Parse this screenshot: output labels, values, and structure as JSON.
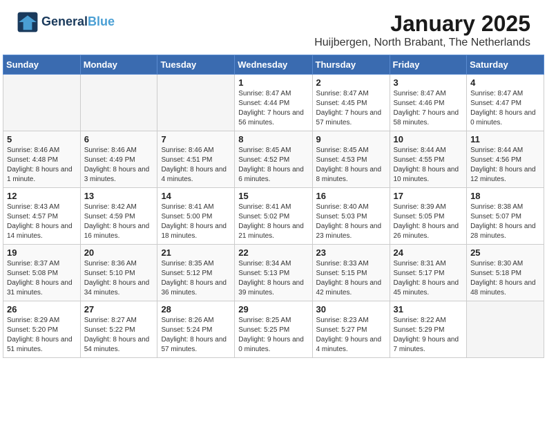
{
  "logo": {
    "line1": "General",
    "line2": "Blue"
  },
  "header": {
    "month": "January 2025",
    "location": "Huijbergen, North Brabant, The Netherlands"
  },
  "weekdays": [
    "Sunday",
    "Monday",
    "Tuesday",
    "Wednesday",
    "Thursday",
    "Friday",
    "Saturday"
  ],
  "weeks": [
    [
      {
        "day": "",
        "info": ""
      },
      {
        "day": "",
        "info": ""
      },
      {
        "day": "",
        "info": ""
      },
      {
        "day": "1",
        "info": "Sunrise: 8:47 AM\nSunset: 4:44 PM\nDaylight: 7 hours and 56 minutes."
      },
      {
        "day": "2",
        "info": "Sunrise: 8:47 AM\nSunset: 4:45 PM\nDaylight: 7 hours and 57 minutes."
      },
      {
        "day": "3",
        "info": "Sunrise: 8:47 AM\nSunset: 4:46 PM\nDaylight: 7 hours and 58 minutes."
      },
      {
        "day": "4",
        "info": "Sunrise: 8:47 AM\nSunset: 4:47 PM\nDaylight: 8 hours and 0 minutes."
      }
    ],
    [
      {
        "day": "5",
        "info": "Sunrise: 8:46 AM\nSunset: 4:48 PM\nDaylight: 8 hours and 1 minute."
      },
      {
        "day": "6",
        "info": "Sunrise: 8:46 AM\nSunset: 4:49 PM\nDaylight: 8 hours and 3 minutes."
      },
      {
        "day": "7",
        "info": "Sunrise: 8:46 AM\nSunset: 4:51 PM\nDaylight: 8 hours and 4 minutes."
      },
      {
        "day": "8",
        "info": "Sunrise: 8:45 AM\nSunset: 4:52 PM\nDaylight: 8 hours and 6 minutes."
      },
      {
        "day": "9",
        "info": "Sunrise: 8:45 AM\nSunset: 4:53 PM\nDaylight: 8 hours and 8 minutes."
      },
      {
        "day": "10",
        "info": "Sunrise: 8:44 AM\nSunset: 4:55 PM\nDaylight: 8 hours and 10 minutes."
      },
      {
        "day": "11",
        "info": "Sunrise: 8:44 AM\nSunset: 4:56 PM\nDaylight: 8 hours and 12 minutes."
      }
    ],
    [
      {
        "day": "12",
        "info": "Sunrise: 8:43 AM\nSunset: 4:57 PM\nDaylight: 8 hours and 14 minutes."
      },
      {
        "day": "13",
        "info": "Sunrise: 8:42 AM\nSunset: 4:59 PM\nDaylight: 8 hours and 16 minutes."
      },
      {
        "day": "14",
        "info": "Sunrise: 8:41 AM\nSunset: 5:00 PM\nDaylight: 8 hours and 18 minutes."
      },
      {
        "day": "15",
        "info": "Sunrise: 8:41 AM\nSunset: 5:02 PM\nDaylight: 8 hours and 21 minutes."
      },
      {
        "day": "16",
        "info": "Sunrise: 8:40 AM\nSunset: 5:03 PM\nDaylight: 8 hours and 23 minutes."
      },
      {
        "day": "17",
        "info": "Sunrise: 8:39 AM\nSunset: 5:05 PM\nDaylight: 8 hours and 26 minutes."
      },
      {
        "day": "18",
        "info": "Sunrise: 8:38 AM\nSunset: 5:07 PM\nDaylight: 8 hours and 28 minutes."
      }
    ],
    [
      {
        "day": "19",
        "info": "Sunrise: 8:37 AM\nSunset: 5:08 PM\nDaylight: 8 hours and 31 minutes."
      },
      {
        "day": "20",
        "info": "Sunrise: 8:36 AM\nSunset: 5:10 PM\nDaylight: 8 hours and 34 minutes."
      },
      {
        "day": "21",
        "info": "Sunrise: 8:35 AM\nSunset: 5:12 PM\nDaylight: 8 hours and 36 minutes."
      },
      {
        "day": "22",
        "info": "Sunrise: 8:34 AM\nSunset: 5:13 PM\nDaylight: 8 hours and 39 minutes."
      },
      {
        "day": "23",
        "info": "Sunrise: 8:33 AM\nSunset: 5:15 PM\nDaylight: 8 hours and 42 minutes."
      },
      {
        "day": "24",
        "info": "Sunrise: 8:31 AM\nSunset: 5:17 PM\nDaylight: 8 hours and 45 minutes."
      },
      {
        "day": "25",
        "info": "Sunrise: 8:30 AM\nSunset: 5:18 PM\nDaylight: 8 hours and 48 minutes."
      }
    ],
    [
      {
        "day": "26",
        "info": "Sunrise: 8:29 AM\nSunset: 5:20 PM\nDaylight: 8 hours and 51 minutes."
      },
      {
        "day": "27",
        "info": "Sunrise: 8:27 AM\nSunset: 5:22 PM\nDaylight: 8 hours and 54 minutes."
      },
      {
        "day": "28",
        "info": "Sunrise: 8:26 AM\nSunset: 5:24 PM\nDaylight: 8 hours and 57 minutes."
      },
      {
        "day": "29",
        "info": "Sunrise: 8:25 AM\nSunset: 5:25 PM\nDaylight: 9 hours and 0 minutes."
      },
      {
        "day": "30",
        "info": "Sunrise: 8:23 AM\nSunset: 5:27 PM\nDaylight: 9 hours and 4 minutes."
      },
      {
        "day": "31",
        "info": "Sunrise: 8:22 AM\nSunset: 5:29 PM\nDaylight: 9 hours and 7 minutes."
      },
      {
        "day": "",
        "info": ""
      }
    ]
  ]
}
